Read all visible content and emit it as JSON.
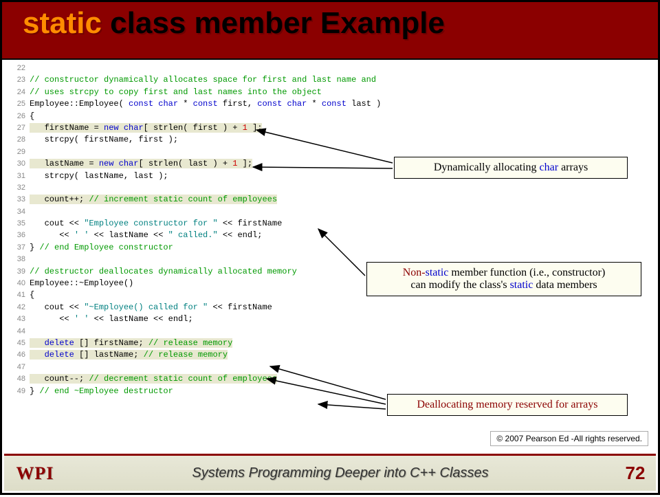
{
  "title": {
    "kw": "static",
    "rest": " class member Example"
  },
  "code": [
    {
      "n": 22,
      "t": ""
    },
    {
      "n": 23,
      "t": "// constructor dynamically allocates space for first and last name and",
      "cls": "cm"
    },
    {
      "n": 24,
      "t": "// uses strcpy to copy first and last names into the object",
      "cls": "cm"
    },
    {
      "n": 25,
      "seg": [
        {
          "t": "Employee::Employee( "
        },
        {
          "t": "const char",
          "c": "kw2"
        },
        {
          "t": " * "
        },
        {
          "t": "const",
          "c": "kw2"
        },
        {
          "t": " first, "
        },
        {
          "t": "const char",
          "c": "kw2"
        },
        {
          "t": " * "
        },
        {
          "t": "const",
          "c": "kw2"
        },
        {
          "t": " last )"
        }
      ]
    },
    {
      "n": 26,
      "t": "{"
    },
    {
      "n": 27,
      "seg": [
        {
          "t": "   firstName = "
        },
        {
          "t": "new char",
          "c": "kw2"
        },
        {
          "t": "[ strlen( first ) + "
        },
        {
          "t": "1",
          "c": "num"
        },
        {
          "t": " ];"
        }
      ],
      "hl": true
    },
    {
      "n": 28,
      "t": "   strcpy( firstName, first );"
    },
    {
      "n": 29,
      "t": ""
    },
    {
      "n": 30,
      "seg": [
        {
          "t": "   lastName = "
        },
        {
          "t": "new char",
          "c": "kw2"
        },
        {
          "t": "[ strlen( last ) + "
        },
        {
          "t": "1",
          "c": "num"
        },
        {
          "t": " ];"
        }
      ],
      "hl": true
    },
    {
      "n": 31,
      "t": "   strcpy( lastName, last );"
    },
    {
      "n": 32,
      "t": ""
    },
    {
      "n": 33,
      "seg": [
        {
          "t": "   count++; ",
          "hl": true
        },
        {
          "t": "// increment static count of employees",
          "c": "cm",
          "hl": true
        }
      ],
      "hl": true
    },
    {
      "n": 34,
      "t": ""
    },
    {
      "n": 35,
      "seg": [
        {
          "t": "   cout << "
        },
        {
          "t": "\"Employee constructor for \"",
          "c": "str"
        },
        {
          "t": " << firstName"
        }
      ]
    },
    {
      "n": 36,
      "seg": [
        {
          "t": "      << "
        },
        {
          "t": "' '",
          "c": "str"
        },
        {
          "t": " << lastName << "
        },
        {
          "t": "\" called.\"",
          "c": "str"
        },
        {
          "t": " << endl;"
        }
      ]
    },
    {
      "n": 37,
      "seg": [
        {
          "t": "} "
        },
        {
          "t": "// end Employee constructor",
          "c": "cm"
        }
      ]
    },
    {
      "n": 38,
      "t": ""
    },
    {
      "n": 39,
      "t": "// destructor deallocates dynamically allocated memory",
      "cls": "cm"
    },
    {
      "n": 40,
      "t": "Employee::~Employee()"
    },
    {
      "n": 41,
      "t": "{"
    },
    {
      "n": 42,
      "seg": [
        {
          "t": "   cout << "
        },
        {
          "t": "\"~Employee() called for \"",
          "c": "str"
        },
        {
          "t": " << firstName"
        }
      ]
    },
    {
      "n": 43,
      "seg": [
        {
          "t": "      << "
        },
        {
          "t": "' '",
          "c": "str"
        },
        {
          "t": " << lastName << endl;"
        }
      ]
    },
    {
      "n": 44,
      "t": ""
    },
    {
      "n": 45,
      "seg": [
        {
          "t": "   "
        },
        {
          "t": "delete",
          "c": "kw2"
        },
        {
          "t": " [] firstName; ",
          "hl": true
        },
        {
          "t": "// release memory",
          "c": "cm",
          "hl": true
        }
      ],
      "hl": true
    },
    {
      "n": 46,
      "seg": [
        {
          "t": "   "
        },
        {
          "t": "delete",
          "c": "kw2"
        },
        {
          "t": " [] lastName; ",
          "hl": true
        },
        {
          "t": "// release memory",
          "c": "cm",
          "hl": true
        }
      ],
      "hl": true
    },
    {
      "n": 47,
      "t": ""
    },
    {
      "n": 48,
      "seg": [
        {
          "t": "   count--; ",
          "hl": true
        },
        {
          "t": "// decrement static count of employees",
          "c": "cm",
          "hl": true
        }
      ],
      "hl": true
    },
    {
      "n": 49,
      "seg": [
        {
          "t": "} "
        },
        {
          "t": "// end ~Employee destructor",
          "c": "cm"
        }
      ]
    }
  ],
  "callouts": {
    "c1": {
      "pre": "Dynamically allocating ",
      "kw": "char",
      "post": " arrays"
    },
    "c2_line1": {
      "a": "Non-",
      "b": "static",
      "c": " member function (i.e., constructor)"
    },
    "c2_line2": {
      "a": "can modify the class's ",
      "b": "static",
      "c": " data members"
    },
    "c3": "Deallocating memory reserved for arrays"
  },
  "copyright": "© 2007 Pearson Ed -All rights reserved.",
  "footer": {
    "logo": "WPI",
    "text": "Systems Programming     Deeper into C++ Classes",
    "page": "72"
  }
}
